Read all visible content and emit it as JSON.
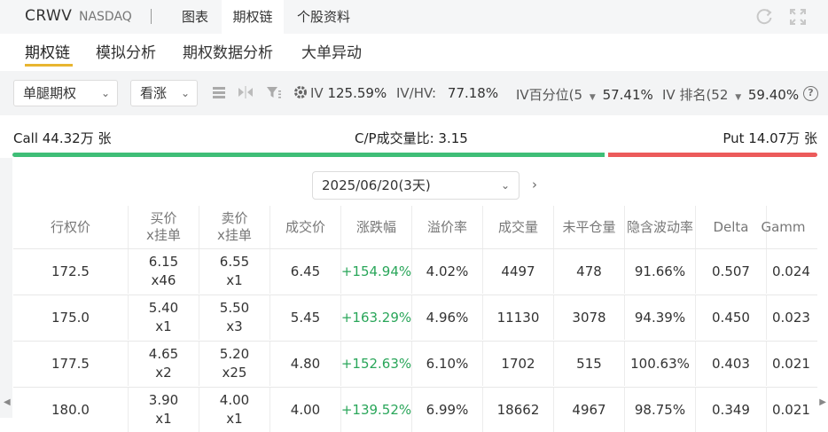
{
  "header": {
    "ticker": "CRWV",
    "exchange": "NASDAQ",
    "tabs": [
      "图表",
      "期权链",
      "个股资料"
    ],
    "active_tab": "期权链",
    "icons": [
      "refresh-icon",
      "expand-icon"
    ]
  },
  "subtabs": [
    "期权链",
    "模拟分析",
    "期权数据分析",
    "大单异动"
  ],
  "filters": {
    "leg": "单腿期权",
    "direction": "看涨",
    "iv_label": "IV",
    "iv_value": "125.59%",
    "ivhv_label": "IV/HV:",
    "ivhv_value": "77.18%",
    "ivpct_label": "IV百分位(5",
    "ivpct_value": "57.41%",
    "ivrank_label": "IV 排名(52",
    "ivrank_value": "59.40%",
    "info_icon": "?"
  },
  "volume": {
    "call": "Call 44.32万 张",
    "ratio": "C/P成交量比:  3.15",
    "put": "Put 14.07万 张",
    "call_share": 0.76
  },
  "expiry": {
    "date": "2025/06/20(3天)",
    "next": "›"
  },
  "table": {
    "headers": [
      [
        "行权价"
      ],
      [
        "买价",
        "x挂单"
      ],
      [
        "卖价",
        "x挂单"
      ],
      [
        "成交价"
      ],
      [
        "涨跌幅"
      ],
      [
        "溢价率"
      ],
      [
        "成交量"
      ],
      [
        "未平仓量"
      ],
      [
        "隐含波动率"
      ],
      [
        "Delta"
      ],
      [
        "Gamm"
      ]
    ],
    "rows": [
      {
        "strike": "172.5",
        "bid": "6.15",
        "bid_size": "x46",
        "ask": "6.55",
        "ask_size": "x1",
        "last": "6.45",
        "change": "+154.94%",
        "premium": "4.02%",
        "volume": "4497",
        "oi": "478",
        "iv": "91.66%",
        "delta": "0.507",
        "gamma": "0.024"
      },
      {
        "strike": "175.0",
        "bid": "5.40",
        "bid_size": "x1",
        "ask": "5.50",
        "ask_size": "x3",
        "last": "5.45",
        "change": "+163.29%",
        "premium": "4.96%",
        "volume": "11130",
        "oi": "3078",
        "iv": "94.39%",
        "delta": "0.450",
        "gamma": "0.023"
      },
      {
        "strike": "177.5",
        "bid": "4.65",
        "bid_size": "x2",
        "ask": "5.20",
        "ask_size": "x25",
        "last": "4.80",
        "change": "+152.63%",
        "premium": "6.10%",
        "volume": "1702",
        "oi": "515",
        "iv": "100.63%",
        "delta": "0.403",
        "gamma": "0.021"
      },
      {
        "strike": "180.0",
        "bid": "3.90",
        "bid_size": "x1",
        "ask": "4.00",
        "ask_size": "x1",
        "last": "4.00",
        "change": "+139.52%",
        "premium": "6.99%",
        "volume": "18662",
        "oi": "4967",
        "iv": "98.75%",
        "delta": "0.349",
        "gamma": "0.021"
      }
    ]
  },
  "colors": {
    "call_bar": "#3fbe77",
    "put_bar": "#ec5b5b",
    "positive": "#2aa65a",
    "tab_underline": "#e8b530"
  }
}
